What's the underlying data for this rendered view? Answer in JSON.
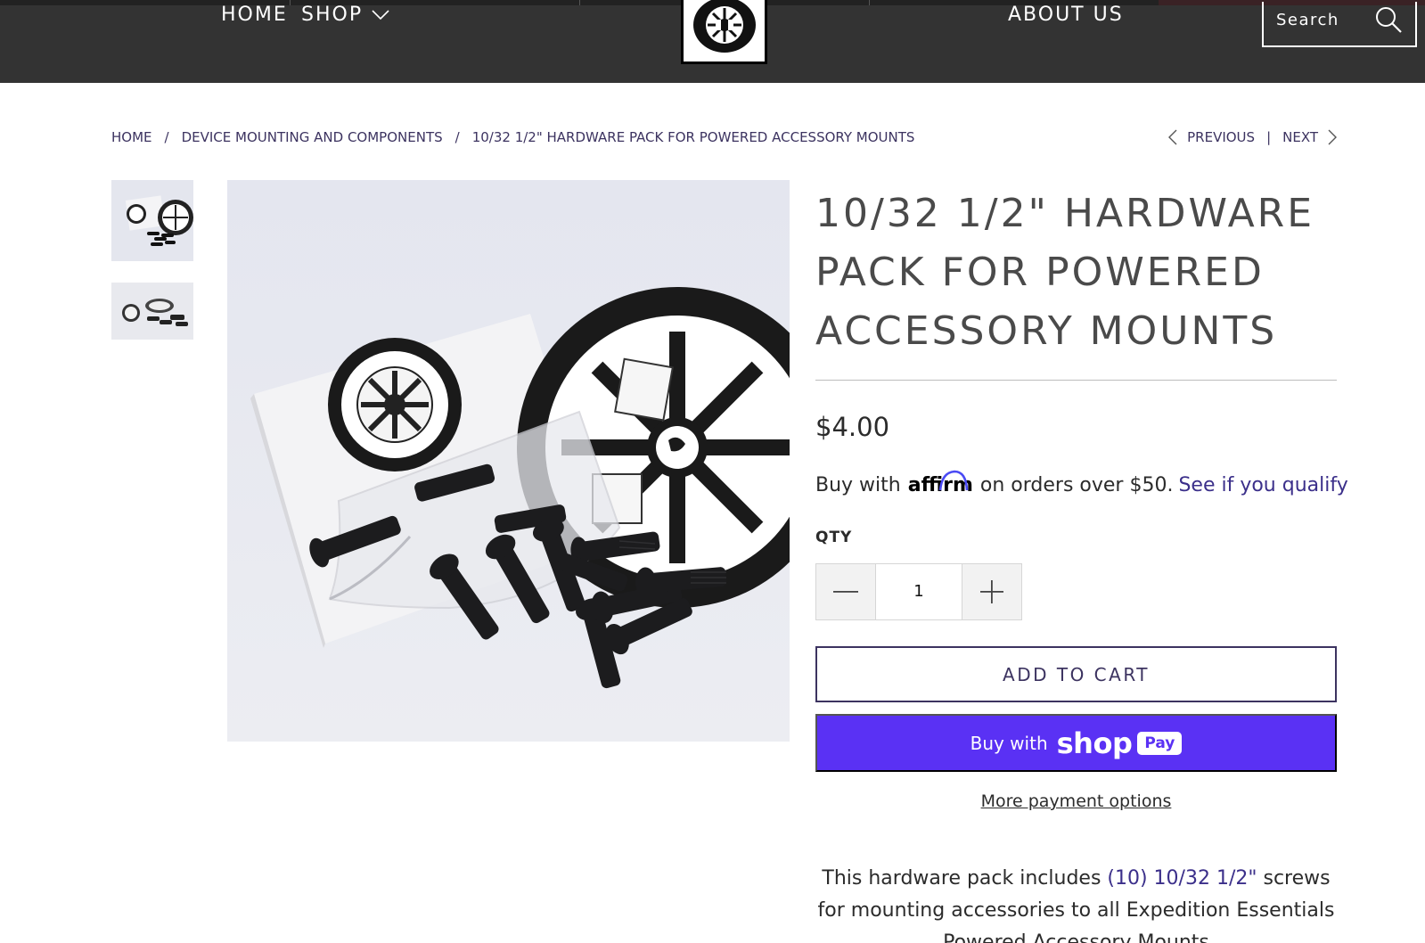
{
  "header": {
    "nav": {
      "home": "HOME",
      "shop": "SHOP",
      "about": "ABOUT US"
    },
    "search": {
      "placeholder": "Search"
    },
    "colors": {
      "background": "#333333",
      "text": "#ffffff"
    }
  },
  "breadcrumb": {
    "items": [
      "HOME",
      "DEVICE MOUNTING AND COMPONENTS",
      "10/32 1/2\" HARDWARE PACK FOR POWERED ACCESSORY MOUNTS"
    ],
    "separator": "/"
  },
  "pager": {
    "previous": "PREVIOUS",
    "separator": "|",
    "next": "NEXT"
  },
  "product": {
    "title_lines": [
      "10/32 1/2\" HARDWARE",
      "PACK FOR POWERED",
      "ACCESSORY MOUNTS"
    ],
    "price": "$4.00",
    "affirm": {
      "prefix": "Buy with",
      "logo": "affirm",
      "suffix": "on orders over $50.",
      "link": "See if you qualify"
    },
    "qty_label": "QTY",
    "qty_value": "1",
    "add_to_cart": "ADD TO CART",
    "shop_pay": {
      "prefix": "Buy with",
      "brand": "shop",
      "badge": "Pay"
    },
    "more_payment": "More payment options",
    "description": {
      "part1": "This hardware pack includes ",
      "highlight": "(10) 10/32 1/2\"",
      "part2": " screws for mounting accessories to all Expedition Essentials Powered Accessory Mounts"
    }
  },
  "colors": {
    "accent": "#3c3360",
    "shop_pay": "#5a31f4",
    "link": "#3b2f8a"
  },
  "icons": [
    "chevron-down-icon",
    "search-icon",
    "chevron-left-icon",
    "chevron-right-icon",
    "minus-icon",
    "plus-icon"
  ]
}
